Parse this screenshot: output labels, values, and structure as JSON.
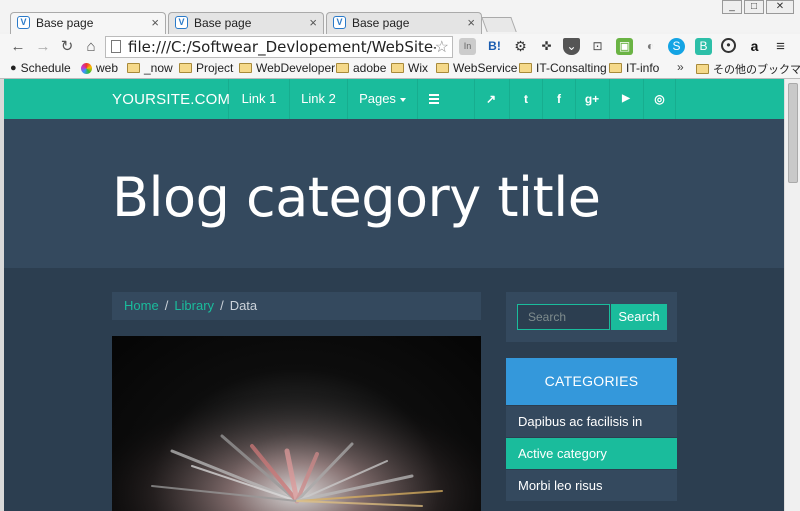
{
  "browser": {
    "tabs": [
      {
        "label": "Base page",
        "close": "×"
      },
      {
        "label": "Base page",
        "close": "×"
      },
      {
        "label": "Base page",
        "close": "×"
      }
    ],
    "url": "file:///C:/Softwear_Devlopement/WebSite-Catal",
    "bookmarks": [
      "Schedule",
      "web",
      "_now",
      "Project",
      "WebDeveloper",
      "adobe",
      "Wix",
      "WebService",
      "IT-Consalting",
      "IT-info"
    ],
    "bookmarks_overflow": "»",
    "other_bookmarks": "その他のブックマーク",
    "extension_icons": [
      "In",
      "B!",
      "gear-icon",
      "puzzle-icon",
      "pocket-icon",
      "cast-icon",
      "android-icon",
      "translate-icon",
      "skype-icon",
      "b-icon",
      "record-icon",
      "a",
      "menu-icon"
    ]
  },
  "site": {
    "brand": "YOURSITE.COM",
    "nav": [
      "Link 1",
      "Link 2",
      "Pages"
    ],
    "social_icons": [
      "share-icon",
      "twitter-icon",
      "facebook-icon",
      "google-plus-icon",
      "youtube-icon",
      "dribbble-icon"
    ],
    "social_glyphs": [
      "↗",
      "t",
      "f",
      "g+",
      "▶",
      "◎"
    ],
    "accent": "#1abc9c",
    "dark": "#2c3e50",
    "mid": "#34495e",
    "blue": "#3498db"
  },
  "hero": {
    "title": "Blog category title"
  },
  "breadcrumb": {
    "items": [
      "Home",
      "Library",
      "Data"
    ],
    "sep": "/"
  },
  "sidebar": {
    "search_placeholder": "Search",
    "search_button": "Search",
    "categories_title": "CATEGORIES",
    "categories": [
      "Dapibus ac facilisis in",
      "Active category",
      "Morbi leo risus"
    ]
  }
}
